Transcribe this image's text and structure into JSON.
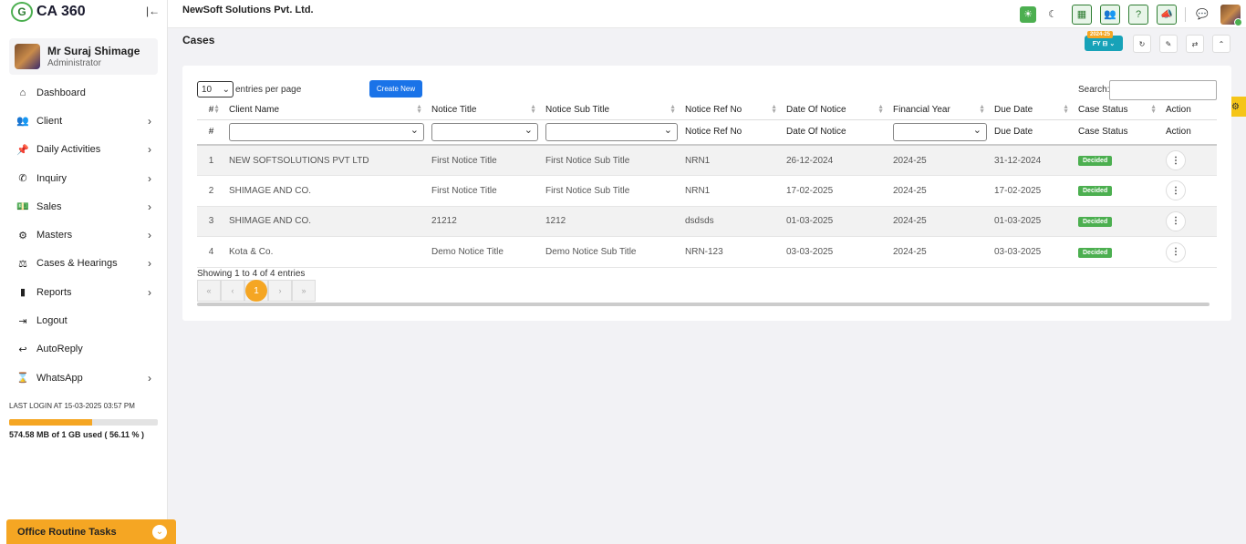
{
  "app": {
    "logo_text": "CA 360",
    "logo_mark": "G",
    "collapse_icon": "|←"
  },
  "user": {
    "name": "Mr Suraj Shimage",
    "role": "Administrator"
  },
  "sidebar": {
    "items": [
      {
        "label": "Dashboard",
        "icon": "home-icon",
        "glyph": "⌂",
        "chevron": false
      },
      {
        "label": "Client",
        "icon": "users-icon",
        "glyph": "👥",
        "chevron": true
      },
      {
        "label": "Daily Activities",
        "icon": "pin-icon",
        "glyph": "📌",
        "chevron": true
      },
      {
        "label": "Inquiry",
        "icon": "phone-icon",
        "glyph": "✆",
        "chevron": true
      },
      {
        "label": "Sales",
        "icon": "money-icon",
        "glyph": "💵",
        "chevron": true
      },
      {
        "label": "Masters",
        "icon": "gears-icon",
        "glyph": "⚙",
        "chevron": true
      },
      {
        "label": "Cases & Hearings",
        "icon": "scale-icon",
        "glyph": "⚖",
        "chevron": true
      },
      {
        "label": "Reports",
        "icon": "file-icon",
        "glyph": "▮",
        "chevron": true
      },
      {
        "label": "Logout",
        "icon": "logout-icon",
        "glyph": "⇥",
        "chevron": false
      },
      {
        "label": "AutoReply",
        "icon": "reply-icon",
        "glyph": "↩",
        "chevron": false
      },
      {
        "label": "WhatsApp",
        "icon": "hourglass-icon",
        "glyph": "⌛",
        "chevron": true
      }
    ],
    "chevron_glyph": "›"
  },
  "last_login": "LAST LOGIN AT 15-03-2025 03:57 PM",
  "storage": {
    "text": "574.58 MB of 1 GB used ( 56.11 % )",
    "fraction": 0.5611
  },
  "routine": {
    "label": "Office Routine Tasks",
    "toggle": "⌄"
  },
  "topbar": {
    "company": "NewSoft Solutions Pvt. Ltd.",
    "icons": {
      "sun": "☀",
      "moon": "☾",
      "grid": "▦",
      "team": "👥",
      "help": "?",
      "megaphone": "📣",
      "chat": "💬"
    }
  },
  "page": {
    "title": "Cases"
  },
  "fy": {
    "label": "FY ⊟ ⌄",
    "year": "2024-25"
  },
  "header_buttons": {
    "refresh": "↻",
    "pin": "✎",
    "sync": "⇄",
    "up": "⌃"
  },
  "side_tab": {
    "icon": "⚙"
  },
  "table_controls": {
    "length_value": "10",
    "length_chevron": "⌄",
    "length_label": "entries per page",
    "create_button": "Create New",
    "search_label": "Search:",
    "search_value": ""
  },
  "columns": [
    "#",
    "Client Name",
    "Notice Title",
    "Notice Sub Title",
    "Notice Ref No",
    "Date Of Notice",
    "Financial Year",
    "Due Date",
    "Case Status",
    "Action"
  ],
  "filters": [
    "#",
    "",
    "",
    "",
    "Notice Ref No",
    "Date Of Notice",
    "",
    "Due Date",
    "Case Status",
    "Action"
  ],
  "rows": [
    {
      "num": "1",
      "client": "NEW SOFTSOLUTIONS PVT LTD",
      "title": "First Notice Title",
      "subtitle": "First Notice Sub Title",
      "ref": "NRN1",
      "date": "26-12-2024",
      "fy": "2024-25",
      "due": "31-12-2024",
      "status": "Decided",
      "action": "⋮"
    },
    {
      "num": "2",
      "client": "SHIMAGE AND CO.",
      "title": "First Notice Title",
      "subtitle": "First Notice Sub Title",
      "ref": "NRN1",
      "date": "17-02-2025",
      "fy": "2024-25",
      "due": "17-02-2025",
      "status": "Decided",
      "action": "⋮"
    },
    {
      "num": "3",
      "client": "SHIMAGE AND CO.",
      "title": "21212",
      "subtitle": "1212",
      "ref": "dsdsds",
      "date": "01-03-2025",
      "fy": "2024-25",
      "due": "01-03-2025",
      "status": "Decided",
      "action": "⋮"
    },
    {
      "num": "4",
      "client": "Kota & Co.",
      "title": "Demo Notice Title",
      "subtitle": "Demo Notice Sub Title",
      "ref": "NRN-123",
      "date": "03-03-2025",
      "fy": "2024-25",
      "due": "03-03-2025",
      "status": "Decided",
      "action": "⋮"
    }
  ],
  "footer": {
    "info": "Showing 1 to 4 of 4 entries",
    "pager": {
      "first": "«",
      "prev": "‹",
      "current": "1",
      "next": "›",
      "last": "»"
    }
  },
  "colors": {
    "accent": "#f5a623",
    "primary": "#1a73e8",
    "success": "#4caf50",
    "fy": "#17a2b8"
  }
}
